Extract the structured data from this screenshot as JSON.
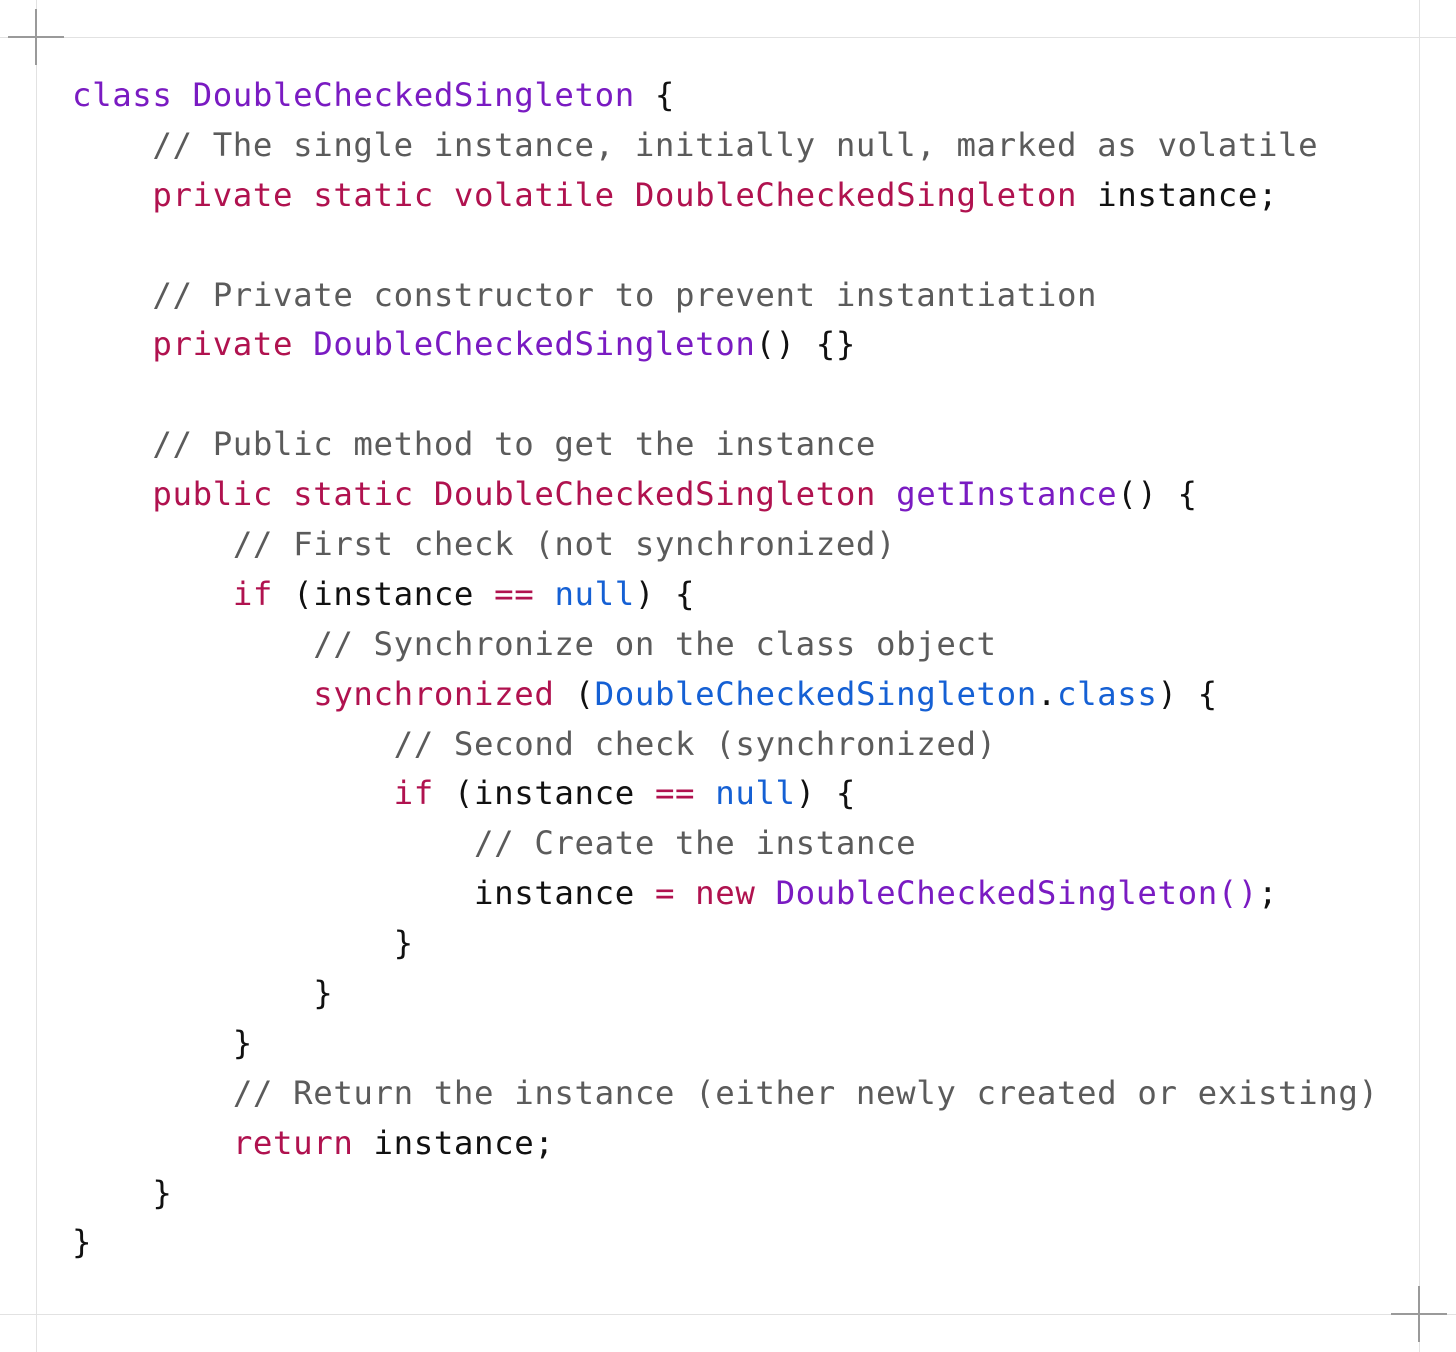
{
  "code": {
    "language": "java",
    "colors": {
      "keyword": "#b0124f",
      "type": "#7a1bc2",
      "literal": "#1560d4",
      "comment": "#5b5b5b",
      "plain": "#111111"
    },
    "lines": [
      [
        {
          "t": "type",
          "s": "class "
        },
        {
          "t": "type",
          "s": "DoubleCheckedSingleton"
        },
        {
          "t": "plain",
          "s": " {"
        }
      ],
      [
        {
          "t": "plain",
          "s": "    "
        },
        {
          "t": "comment",
          "s": "// The single instance, initially null, marked as volatile"
        }
      ],
      [
        {
          "t": "plain",
          "s": "    "
        },
        {
          "t": "kw",
          "s": "private static volatile DoubleCheckedSingleton"
        },
        {
          "t": "plain",
          "s": " instance;"
        }
      ],
      [
        {
          "t": "plain",
          "s": ""
        }
      ],
      [
        {
          "t": "plain",
          "s": "    "
        },
        {
          "t": "comment",
          "s": "// Private constructor to prevent instantiation"
        }
      ],
      [
        {
          "t": "plain",
          "s": "    "
        },
        {
          "t": "kw",
          "s": "private "
        },
        {
          "t": "type",
          "s": "DoubleCheckedSingleton"
        },
        {
          "t": "plain",
          "s": "() {}"
        }
      ],
      [
        {
          "t": "plain",
          "s": ""
        }
      ],
      [
        {
          "t": "plain",
          "s": "    "
        },
        {
          "t": "comment",
          "s": "// Public method to get the instance"
        }
      ],
      [
        {
          "t": "plain",
          "s": "    "
        },
        {
          "t": "kw",
          "s": "public static DoubleCheckedSingleton "
        },
        {
          "t": "type",
          "s": "getInstance"
        },
        {
          "t": "plain",
          "s": "() {"
        }
      ],
      [
        {
          "t": "plain",
          "s": "        "
        },
        {
          "t": "comment",
          "s": "// First check (not synchronized)"
        }
      ],
      [
        {
          "t": "plain",
          "s": "        "
        },
        {
          "t": "kw",
          "s": "if"
        },
        {
          "t": "plain",
          "s": " (instance "
        },
        {
          "t": "kw",
          "s": "=="
        },
        {
          "t": "plain",
          "s": " "
        },
        {
          "t": "lit",
          "s": "null"
        },
        {
          "t": "plain",
          "s": ") {"
        }
      ],
      [
        {
          "t": "plain",
          "s": "            "
        },
        {
          "t": "comment",
          "s": "// Synchronize on the class object"
        }
      ],
      [
        {
          "t": "plain",
          "s": "            "
        },
        {
          "t": "kw",
          "s": "synchronized"
        },
        {
          "t": "plain",
          "s": " ("
        },
        {
          "t": "lit",
          "s": "DoubleCheckedSingleton"
        },
        {
          "t": "plain",
          "s": "."
        },
        {
          "t": "lit",
          "s": "class"
        },
        {
          "t": "plain",
          "s": ") {"
        }
      ],
      [
        {
          "t": "plain",
          "s": "                "
        },
        {
          "t": "comment",
          "s": "// Second check (synchronized)"
        }
      ],
      [
        {
          "t": "plain",
          "s": "                "
        },
        {
          "t": "kw",
          "s": "if"
        },
        {
          "t": "plain",
          "s": " (instance "
        },
        {
          "t": "kw",
          "s": "=="
        },
        {
          "t": "plain",
          "s": " "
        },
        {
          "t": "lit",
          "s": "null"
        },
        {
          "t": "plain",
          "s": ") {"
        }
      ],
      [
        {
          "t": "plain",
          "s": "                    "
        },
        {
          "t": "comment",
          "s": "// Create the instance"
        }
      ],
      [
        {
          "t": "plain",
          "s": "                    instance "
        },
        {
          "t": "kw",
          "s": "="
        },
        {
          "t": "plain",
          "s": " "
        },
        {
          "t": "kw",
          "s": "new"
        },
        {
          "t": "plain",
          "s": " "
        },
        {
          "t": "type",
          "s": "DoubleCheckedSingleton()"
        },
        {
          "t": "plain",
          "s": ";"
        }
      ],
      [
        {
          "t": "plain",
          "s": "                }"
        }
      ],
      [
        {
          "t": "plain",
          "s": "            }"
        }
      ],
      [
        {
          "t": "plain",
          "s": "        }"
        }
      ],
      [
        {
          "t": "plain",
          "s": "        "
        },
        {
          "t": "comment",
          "s": "// Return the instance (either newly created or existing)"
        }
      ],
      [
        {
          "t": "plain",
          "s": "        "
        },
        {
          "t": "kw",
          "s": "return"
        },
        {
          "t": "plain",
          "s": " instance;"
        }
      ],
      [
        {
          "t": "plain",
          "s": "    }"
        }
      ],
      [
        {
          "t": "plain",
          "s": "}"
        }
      ]
    ]
  }
}
